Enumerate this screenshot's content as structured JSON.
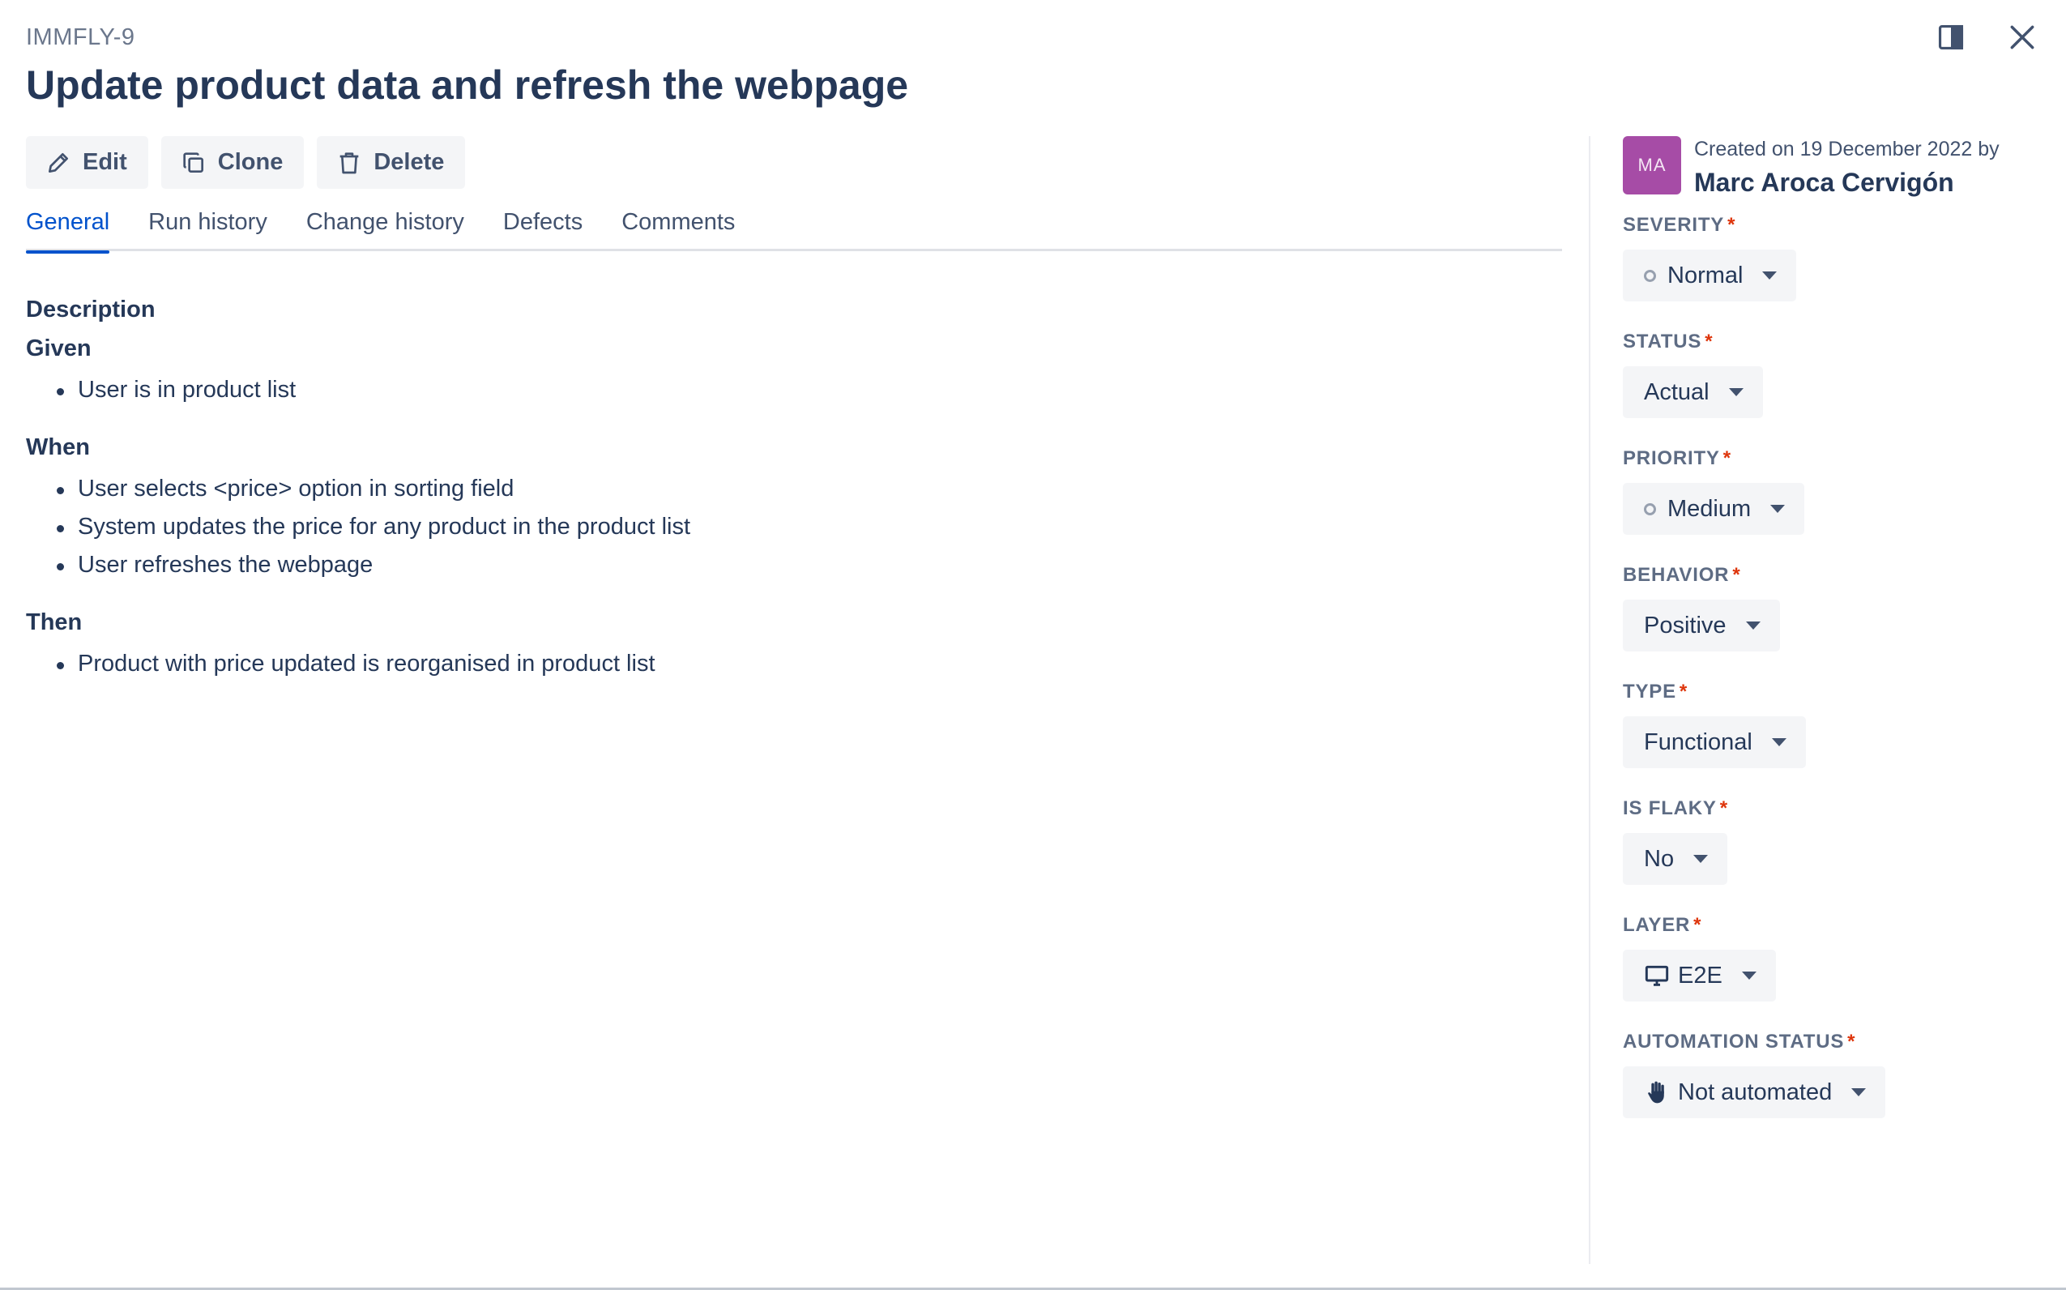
{
  "header": {
    "issue_key": "IMMFLY-9",
    "title": "Update product data and refresh the webpage"
  },
  "toolbar": {
    "edit_label": "Edit",
    "clone_label": "Clone",
    "delete_label": "Delete"
  },
  "tabs": [
    {
      "label": "General",
      "active": true
    },
    {
      "label": "Run history",
      "active": false
    },
    {
      "label": "Change history",
      "active": false
    },
    {
      "label": "Defects",
      "active": false
    },
    {
      "label": "Comments",
      "active": false
    }
  ],
  "description": {
    "label": "Description",
    "sections": [
      {
        "heading": "Given",
        "items": [
          "User is in product list"
        ]
      },
      {
        "heading": "When",
        "items": [
          "User selects <price> option in sorting field",
          "System updates the price for any product in the product list",
          "User refreshes the webpage"
        ]
      },
      {
        "heading": "Then",
        "items": [
          "Product with price updated is reorganised in product list"
        ]
      }
    ]
  },
  "sidebar": {
    "avatar_initials": "MA",
    "created_text": "Created on 19 December 2022 by",
    "creator_name": "Marc Aroca Cervigón",
    "fields": [
      {
        "label": "SEVERITY",
        "value": "Normal",
        "icon": "ring-icon"
      },
      {
        "label": "STATUS",
        "value": "Actual",
        "icon": ""
      },
      {
        "label": "PRIORITY",
        "value": "Medium",
        "icon": "ring-icon"
      },
      {
        "label": "BEHAVIOR",
        "value": "Positive",
        "icon": ""
      },
      {
        "label": "TYPE",
        "value": "Functional",
        "icon": ""
      },
      {
        "label": "IS FLAKY",
        "value": "No",
        "icon": ""
      },
      {
        "label": "LAYER",
        "value": "E2E",
        "icon": "monitor-icon"
      },
      {
        "label": "AUTOMATION STATUS",
        "value": "Not automated",
        "icon": "hand-icon"
      }
    ],
    "required_marker": "*"
  },
  "colors": {
    "accent": "#0052cc",
    "avatar": "#a64ca6",
    "required": "#de350b"
  }
}
